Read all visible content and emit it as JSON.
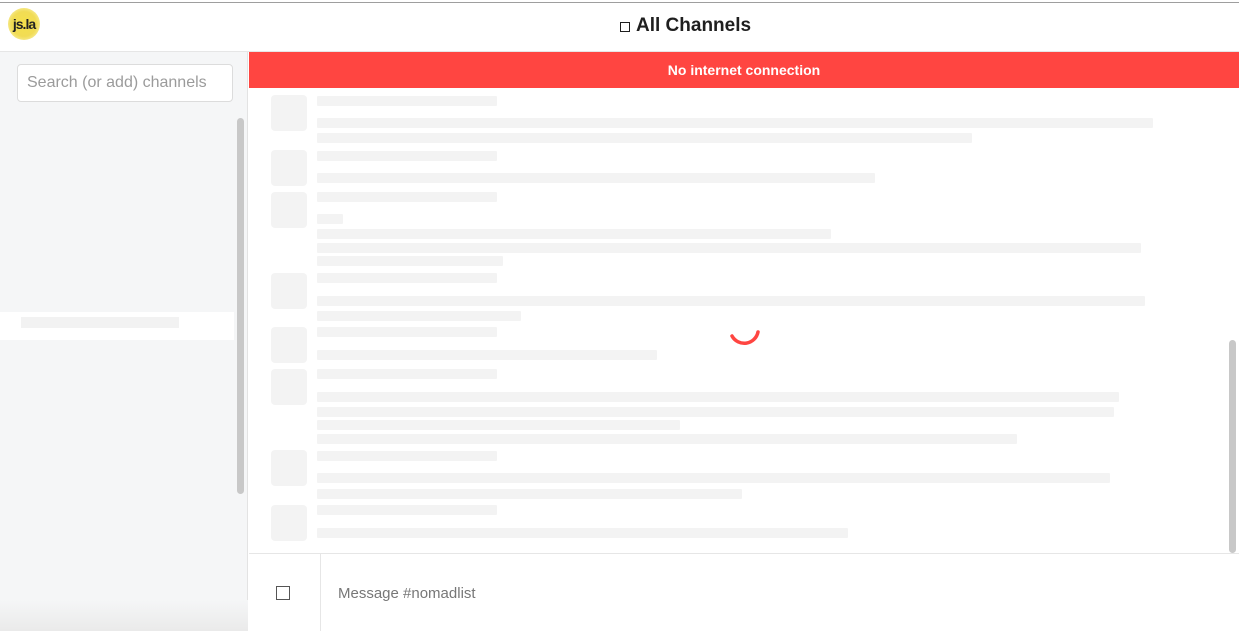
{
  "header": {
    "logo_text": "js.la",
    "title": "All Channels"
  },
  "sidebar": {
    "search_placeholder": "Search (or add) channels"
  },
  "banner": {
    "text": "No internet connection"
  },
  "composer": {
    "placeholder": "Message #nomadlist"
  },
  "colors": {
    "accent": "#ff4541",
    "skeleton": "#f3f3f3",
    "sidebar_bg": "#f5f6f7"
  },
  "icons": {
    "title": "square-icon",
    "attach": "square-icon",
    "loading": "spinner-icon"
  }
}
